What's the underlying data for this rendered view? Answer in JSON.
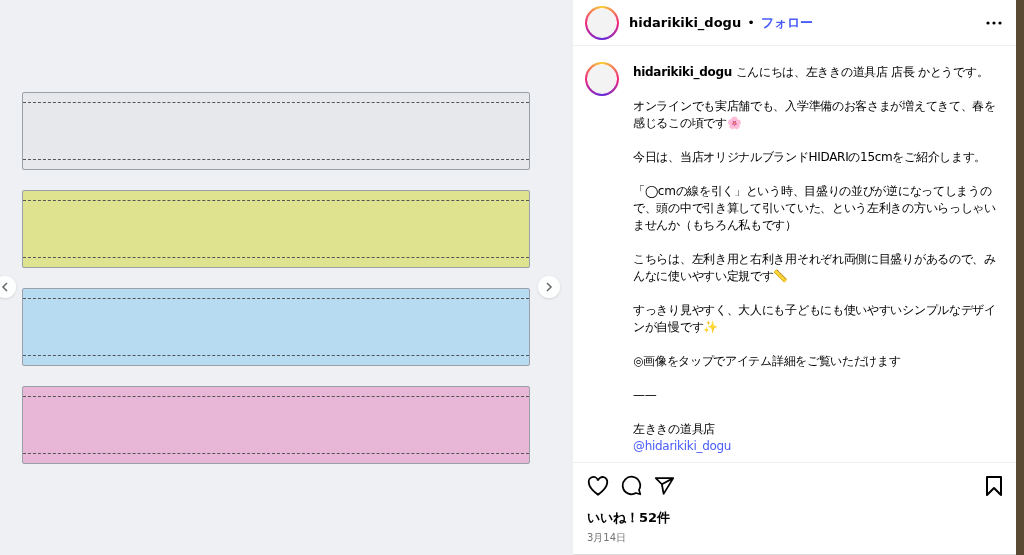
{
  "photo": {
    "rulers": [
      {
        "color": "#e6e8ec"
      },
      {
        "color": "#dfe28f"
      },
      {
        "color": "#b7dcf2"
      },
      {
        "color": "#e8b6d6"
      }
    ]
  },
  "header": {
    "username": "hidarikiki_dogu",
    "separator": "•",
    "follow": "フォロー"
  },
  "caption": {
    "username": "hidarikiki_dogu",
    "paragraphs": [
      "こんにちは、左ききの道具店 店長 かとうです。",
      "オンラインでも実店舗でも、入学準備のお客さまが増えてきて、春を感じるこの頃です🌸",
      "今日は、当店オリジナルブランドHIDARIの15cmをご紹介します。",
      "「◯cmの線を引く」という時、目盛りの並びが逆になってしまうので、頭の中で引き算して引いていた、という左利きの方いらっしゃいませんか（もちろん私もです）",
      "こちらは、左利き用と右利き用それぞれ両側に目盛りがあるので、みんなに使いやすい定規です📏",
      "すっきり見やすく、大人にも子どもにも使いやすいシンプルなデザインが自慢です✨",
      "◎画像をタップでアイテム詳細をご覧いただけます",
      "——"
    ],
    "signature": "左ききの道具店",
    "mention": "@hidarikiki_dogu"
  },
  "likes": "いいね！52件",
  "date": "3月14日"
}
